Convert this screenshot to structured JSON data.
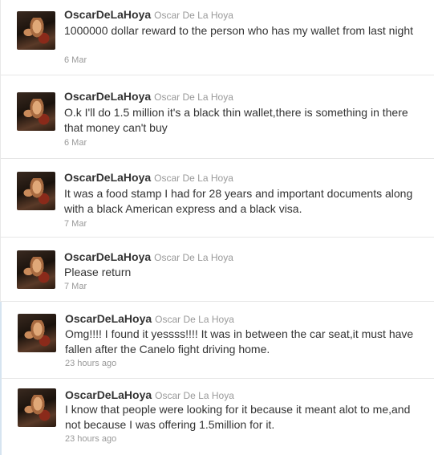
{
  "tweets": [
    {
      "username": "OscarDeLaHoya",
      "fullname": "Oscar De La Hoya",
      "text": "1000000 dollar reward to the person who has my wallet from last night",
      "date": "6 Mar"
    },
    {
      "username": "OscarDeLaHoya",
      "fullname": "Oscar De La Hoya",
      "text": "O.k I'll do 1.5 million it's a black thin wallet,there is something in there that money can't buy",
      "date": "6 Mar"
    },
    {
      "username": "OscarDeLaHoya",
      "fullname": "Oscar De La Hoya",
      "text": "It was a food stamp I had for 28 years and important documents along with a black American express and a black visa.",
      "date": "7 Mar"
    },
    {
      "username": "OscarDeLaHoya",
      "fullname": "Oscar De La Hoya",
      "text": "Please return",
      "date": "7 Mar"
    },
    {
      "username": "OscarDeLaHoya",
      "fullname": "Oscar De La Hoya",
      "text": "Omg!!!! I found it yessss!!!! It was in between the car seat,it must have fallen after the Canelo fight driving home.",
      "date": "23 hours ago"
    },
    {
      "username": "OscarDeLaHoya",
      "fullname": "Oscar De La Hoya",
      "text": "I know that people were looking for it because it meant alot to me,and not because I was offering 1.5million for it.",
      "date": "23 hours ago"
    }
  ]
}
